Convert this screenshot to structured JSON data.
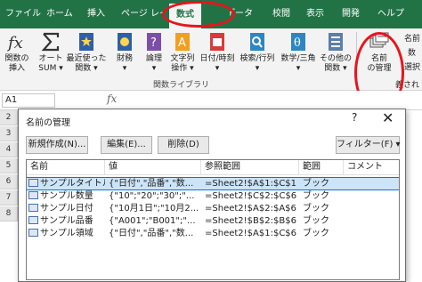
{
  "tabs": [
    {
      "label": "ファイル"
    },
    {
      "label": "ホーム"
    },
    {
      "label": "挿入"
    },
    {
      "label": "ページ レイアウト"
    },
    {
      "label": "数式"
    },
    {
      "label": "データ"
    },
    {
      "label": "校閲"
    },
    {
      "label": "表示"
    },
    {
      "label": "開発"
    },
    {
      "label": "ヘルプ"
    }
  ],
  "ribbon": {
    "buttons": [
      {
        "line1": "関数の",
        "line2": "挿入",
        "icon": "fx-icon"
      },
      {
        "line1": "オート",
        "line2": "SUM ▾",
        "icon": "sigma-icon"
      },
      {
        "line1": "最近使った",
        "line2": "関数 ▾",
        "icon": "star-book-icon"
      },
      {
        "line1": "財務",
        "line2": "▾",
        "icon": "finance-book-icon"
      },
      {
        "line1": "論理",
        "line2": "▾",
        "icon": "logic-book-icon"
      },
      {
        "line1": "文字列",
        "line2": "操作 ▾",
        "icon": "text-book-icon"
      },
      {
        "line1": "日付/時刻",
        "line2": "▾",
        "icon": "calendar-book-icon"
      },
      {
        "line1": "検索/行列",
        "line2": "▾",
        "icon": "lookup-book-icon"
      },
      {
        "line1": "数学/三角",
        "line2": "▾",
        "icon": "math-book-icon"
      },
      {
        "line1": "その他の",
        "line2": "関数 ▾",
        "icon": "more-functions-icon"
      }
    ],
    "group_label": "関数ライブラリ",
    "name_manager": {
      "line1": "名前",
      "line2": "の管理",
      "icon": "name-manager-icon"
    },
    "right_labels": [
      "名前",
      "数",
      "選択",
      "義され"
    ]
  },
  "formula_bar": {
    "name_box": "A1",
    "fx": "fx"
  },
  "sheet": {
    "rows": [
      "2",
      "3",
      "4",
      "5",
      "6",
      "7",
      "8"
    ]
  },
  "dialog": {
    "title": "名前の管理",
    "help": "?",
    "close": "✕",
    "buttons": {
      "new": "新規作成(N)...",
      "edit": "編集(E)...",
      "delete": "削除(D)",
      "filter": "フィルター(F) ▾"
    },
    "columns": [
      "名前",
      "値",
      "参照範囲",
      "範囲",
      "コメント"
    ],
    "rows": [
      {
        "name": "サンプルタイトル",
        "value": "{\"日付\",\"品番\",\"数...",
        "refers_to": "=Sheet2!$A$1:$C$1",
        "scope": "ブック"
      },
      {
        "name": "サンプル数量",
        "value": "{\"10\";\"20\";\"30\";\"...",
        "refers_to": "=Sheet2!$C$2:$C$6",
        "scope": "ブック"
      },
      {
        "name": "サンプル日付",
        "value": "{\"10月1日\";\"10月2...",
        "refers_to": "=Sheet2!$A$2:$A$6",
        "scope": "ブック"
      },
      {
        "name": "サンプル品番",
        "value": "{\"A001\";\"B001\";\"...",
        "refers_to": "=Sheet2!$B$2:$B$6",
        "scope": "ブック"
      },
      {
        "name": "サンプル領域",
        "value": "{\"日付\",\"品番\",\"数...",
        "refers_to": "=Sheet2!$A$1:$C$6",
        "scope": "ブック"
      }
    ],
    "selected_row": 0
  },
  "colors": {
    "excel_green": "#217346",
    "highlight_red": "#e8141c",
    "selection": "#cce4f7"
  }
}
